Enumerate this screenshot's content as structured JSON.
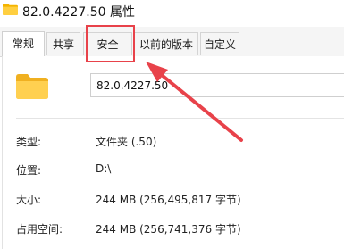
{
  "window": {
    "title": "82.0.4227.50 属性"
  },
  "tabs": [
    {
      "label": "常规",
      "active": true
    },
    {
      "label": "共享",
      "active": false
    },
    {
      "label": "安全",
      "active": false
    },
    {
      "label": "以前的版本",
      "active": false
    },
    {
      "label": "自定义",
      "active": false
    }
  ],
  "general": {
    "name_value": "82.0.4227.50",
    "rows": [
      {
        "label": "类型:",
        "value": "文件夹 (.50)"
      },
      {
        "label": "位置:",
        "value": "D:\\"
      },
      {
        "label": "大小:",
        "value": "244 MB (256,495,817 字节)"
      },
      {
        "label": "占用空间:",
        "value": "244 MB (256,741,376 字节)"
      }
    ]
  },
  "annotation": {
    "box_color": "#e8424a",
    "arrow_color": "#e8424a"
  },
  "icons": {
    "title": "folder-icon",
    "main": "folder-icon"
  }
}
